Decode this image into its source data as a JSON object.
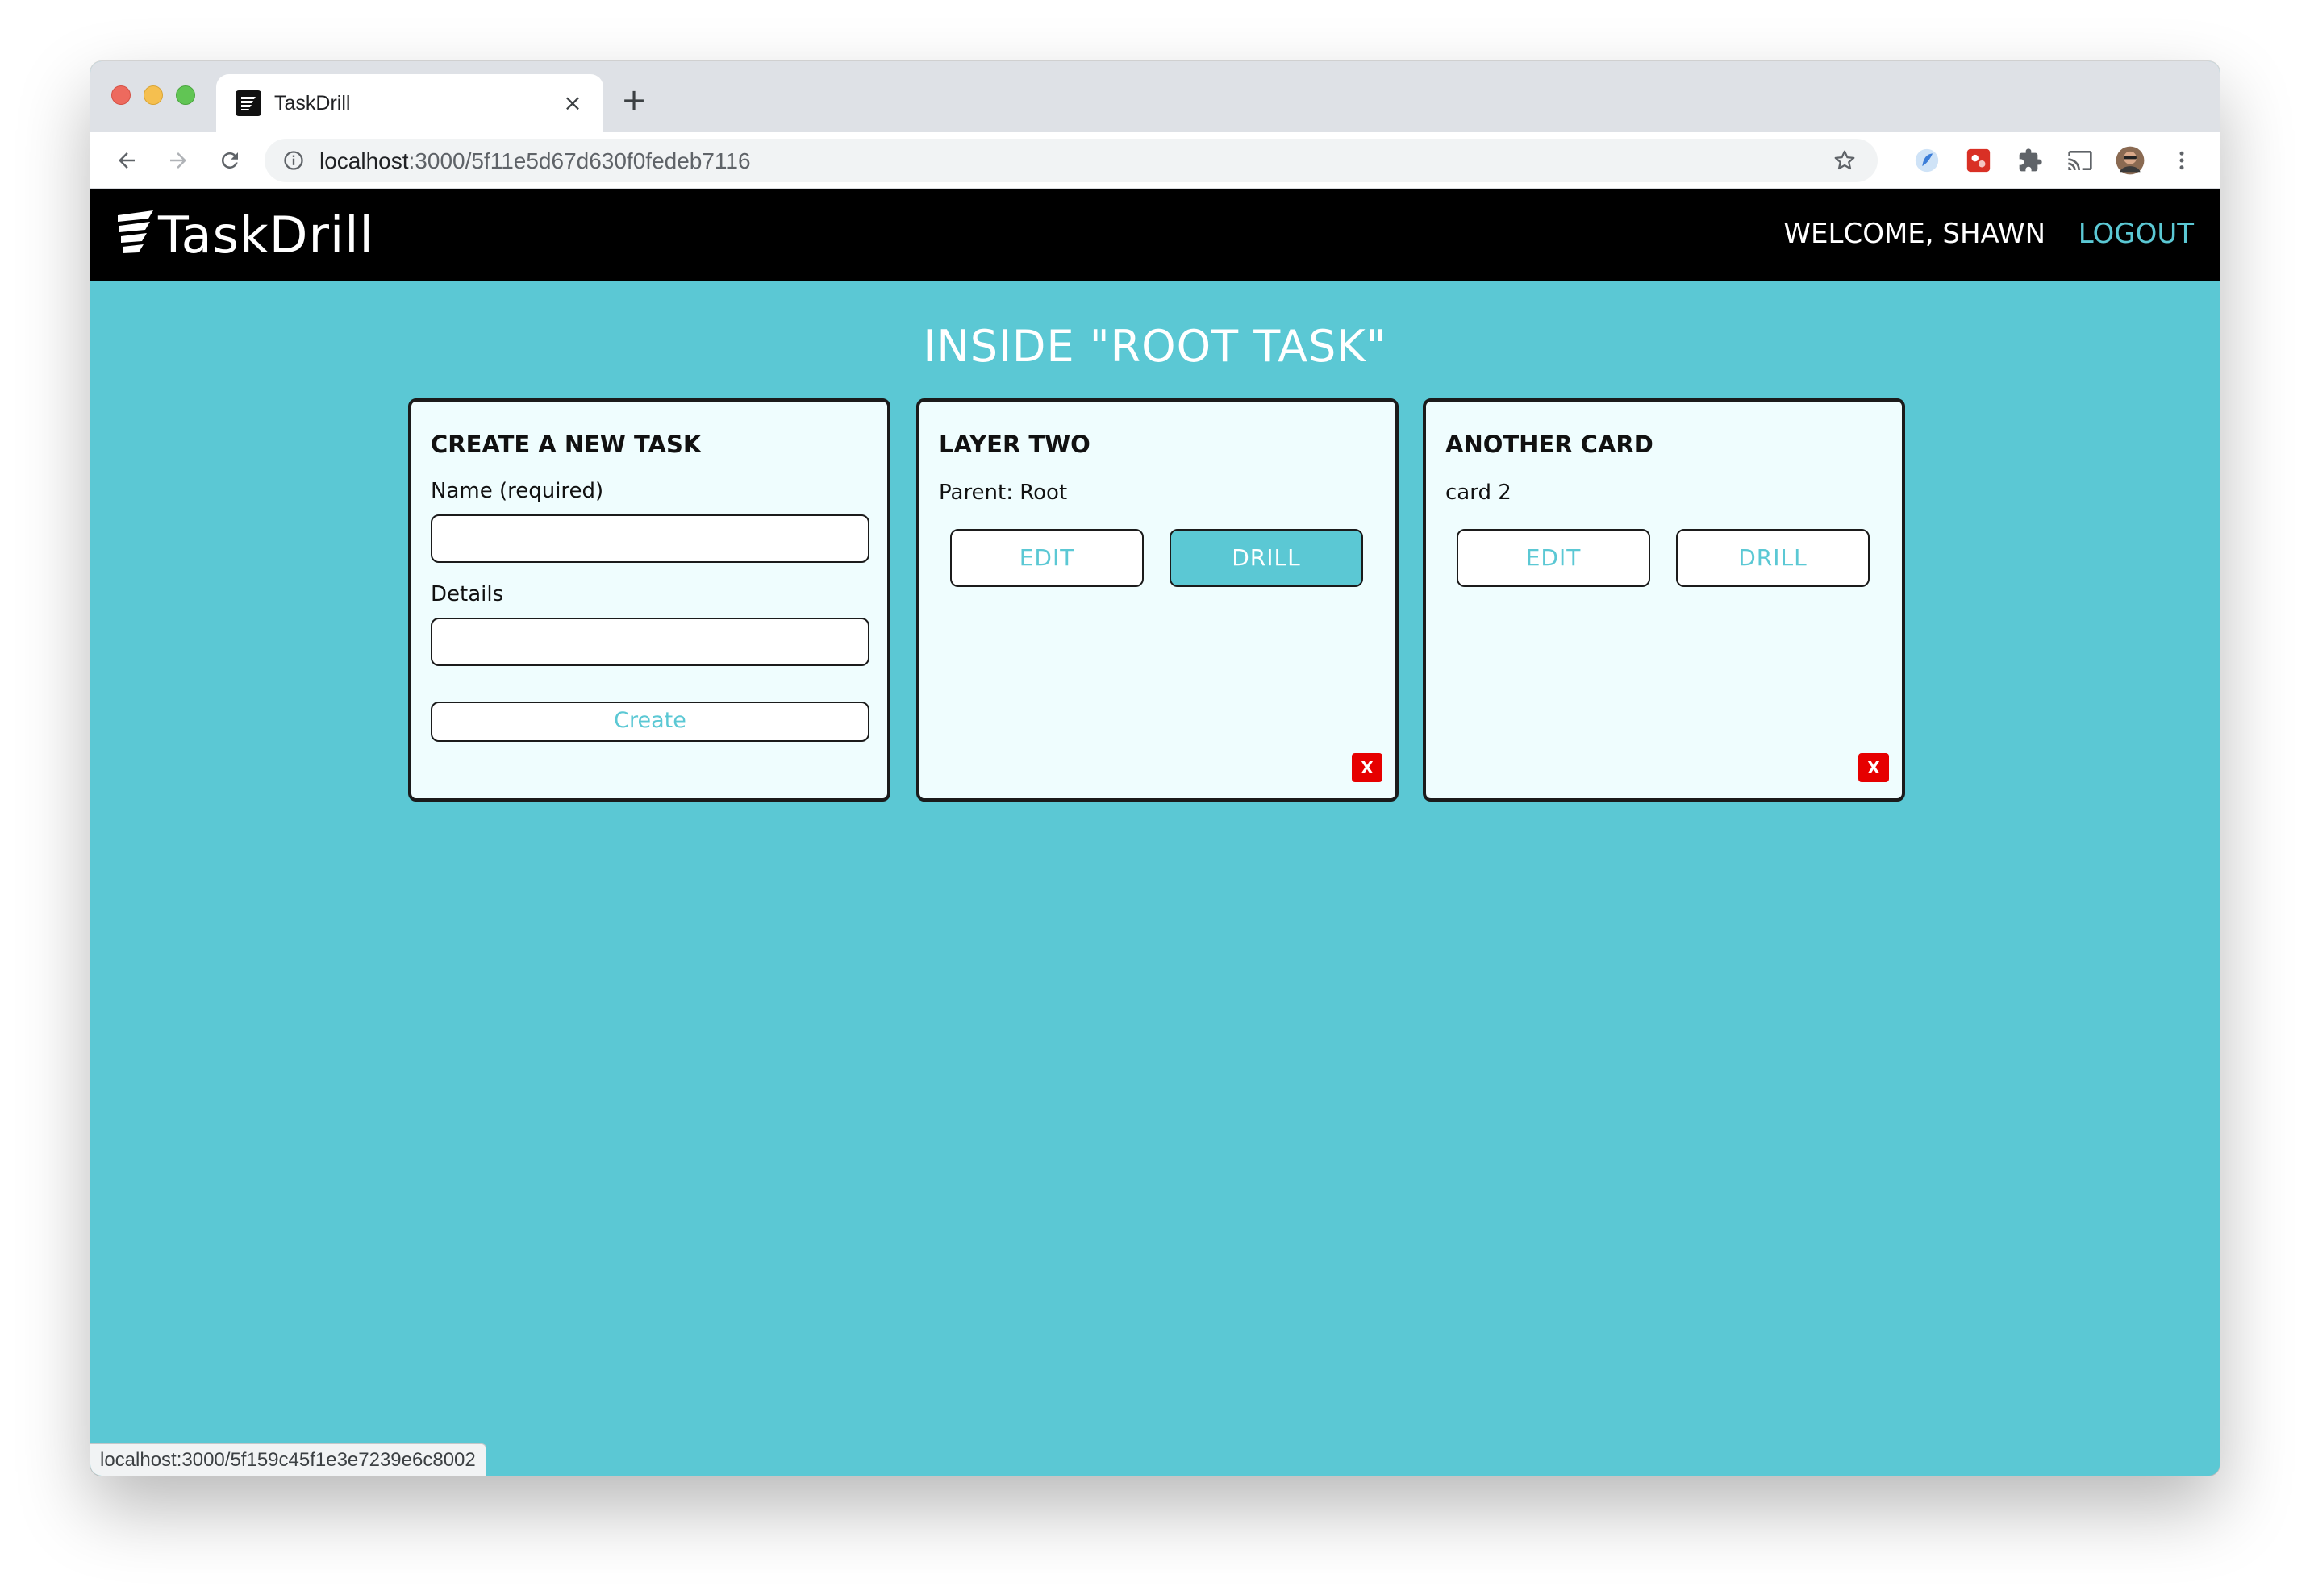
{
  "browser": {
    "tab_title": "TaskDrill",
    "tab_close_glyph": "×",
    "new_tab_glyph": "+",
    "url_host": "localhost",
    "url_path": ":3000/5f11e5d67d630f0fedeb7116",
    "status_url": "localhost:3000/5f159c45f1e3e7239e6c8002"
  },
  "header": {
    "logo_text": "TaskDrill",
    "welcome": "WELCOME, SHAWN",
    "logout": "LOGOUT"
  },
  "page": {
    "heading": "INSIDE \"ROOT TASK\""
  },
  "create_card": {
    "title": "CREATE A NEW TASK",
    "name_label": "Name (required)",
    "details_label": "Details",
    "create_label": "Create"
  },
  "cards": [
    {
      "title": "LAYER TWO",
      "subtitle": "Parent: Root",
      "edit_label": "EDIT",
      "drill_label": "DRILL",
      "delete_label": "X"
    },
    {
      "title": "ANOTHER CARD",
      "subtitle": "card 2",
      "edit_label": "EDIT",
      "drill_label": "DRILL",
      "delete_label": "X"
    }
  ],
  "colors": {
    "accent": "#5bc8d4",
    "header_bg": "#000000",
    "card_bg": "#effdfe",
    "delete": "#e60000"
  },
  "icons": {
    "back": "arrow-left-icon",
    "forward": "arrow-right-icon",
    "reload": "reload-icon",
    "info": "info-icon",
    "bookmark": "star-icon",
    "extensions": [
      "ext-blue-icon",
      "ext-red-icon",
      "puzzle-icon",
      "cast-icon",
      "profile-avatar",
      "kebab-menu-icon"
    ]
  }
}
